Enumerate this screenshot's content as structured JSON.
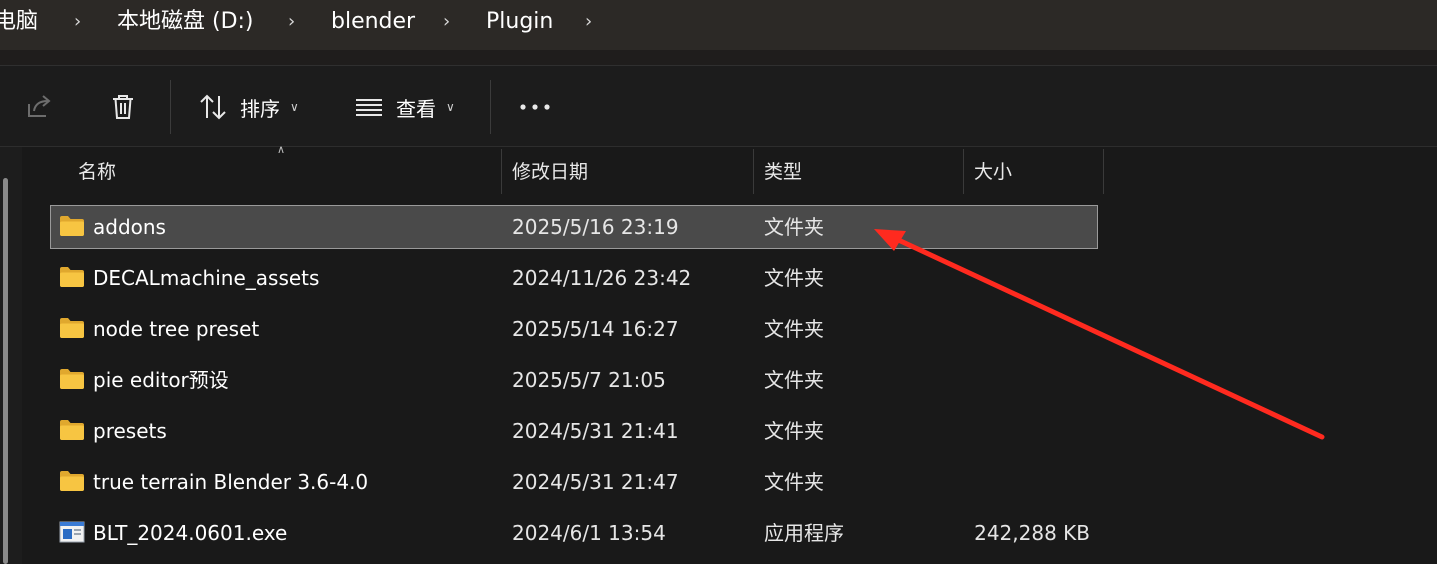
{
  "breadcrumb": {
    "items": [
      "电脑",
      "本地磁盘 (D:)",
      "blender",
      "Plugin"
    ],
    "separator": ">"
  },
  "toolbar": {
    "share_icon": "share-icon",
    "delete_icon": "trash-icon",
    "sort_label": "排序",
    "view_label": "查看",
    "more_icon": "more-icon"
  },
  "columns": {
    "name": "名称",
    "modified": "修改日期",
    "type": "类型",
    "size": "大小"
  },
  "files": [
    {
      "name": "addons",
      "modified": "2025/5/16 23:19",
      "type": "文件夹",
      "size": "",
      "icon": "folder-icon",
      "selected": true
    },
    {
      "name": "DECALmachine_assets",
      "modified": "2024/11/26 23:42",
      "type": "文件夹",
      "size": "",
      "icon": "folder-icon",
      "selected": false
    },
    {
      "name": "node tree preset",
      "modified": "2025/5/14 16:27",
      "type": "文件夹",
      "size": "",
      "icon": "folder-icon",
      "selected": false
    },
    {
      "name": "pie editor预设",
      "modified": "2025/5/7 21:05",
      "type": "文件夹",
      "size": "",
      "icon": "folder-icon",
      "selected": false
    },
    {
      "name": "presets",
      "modified": "2024/5/31 21:41",
      "type": "文件夹",
      "size": "",
      "icon": "folder-icon",
      "selected": false
    },
    {
      "name": "true terrain Blender 3.6-4.0",
      "modified": "2024/5/31 21:47",
      "type": "文件夹",
      "size": "",
      "icon": "folder-icon",
      "selected": false
    },
    {
      "name": "BLT_2024.0601.exe",
      "modified": "2024/6/1 13:54",
      "type": "应用程序",
      "size": "242,288 KB",
      "icon": "exe-icon",
      "selected": false
    }
  ],
  "colors": {
    "folder": "#f7c542",
    "annotation_arrow": "#ff2a1f",
    "selection_bg": "#4a4a4a"
  }
}
